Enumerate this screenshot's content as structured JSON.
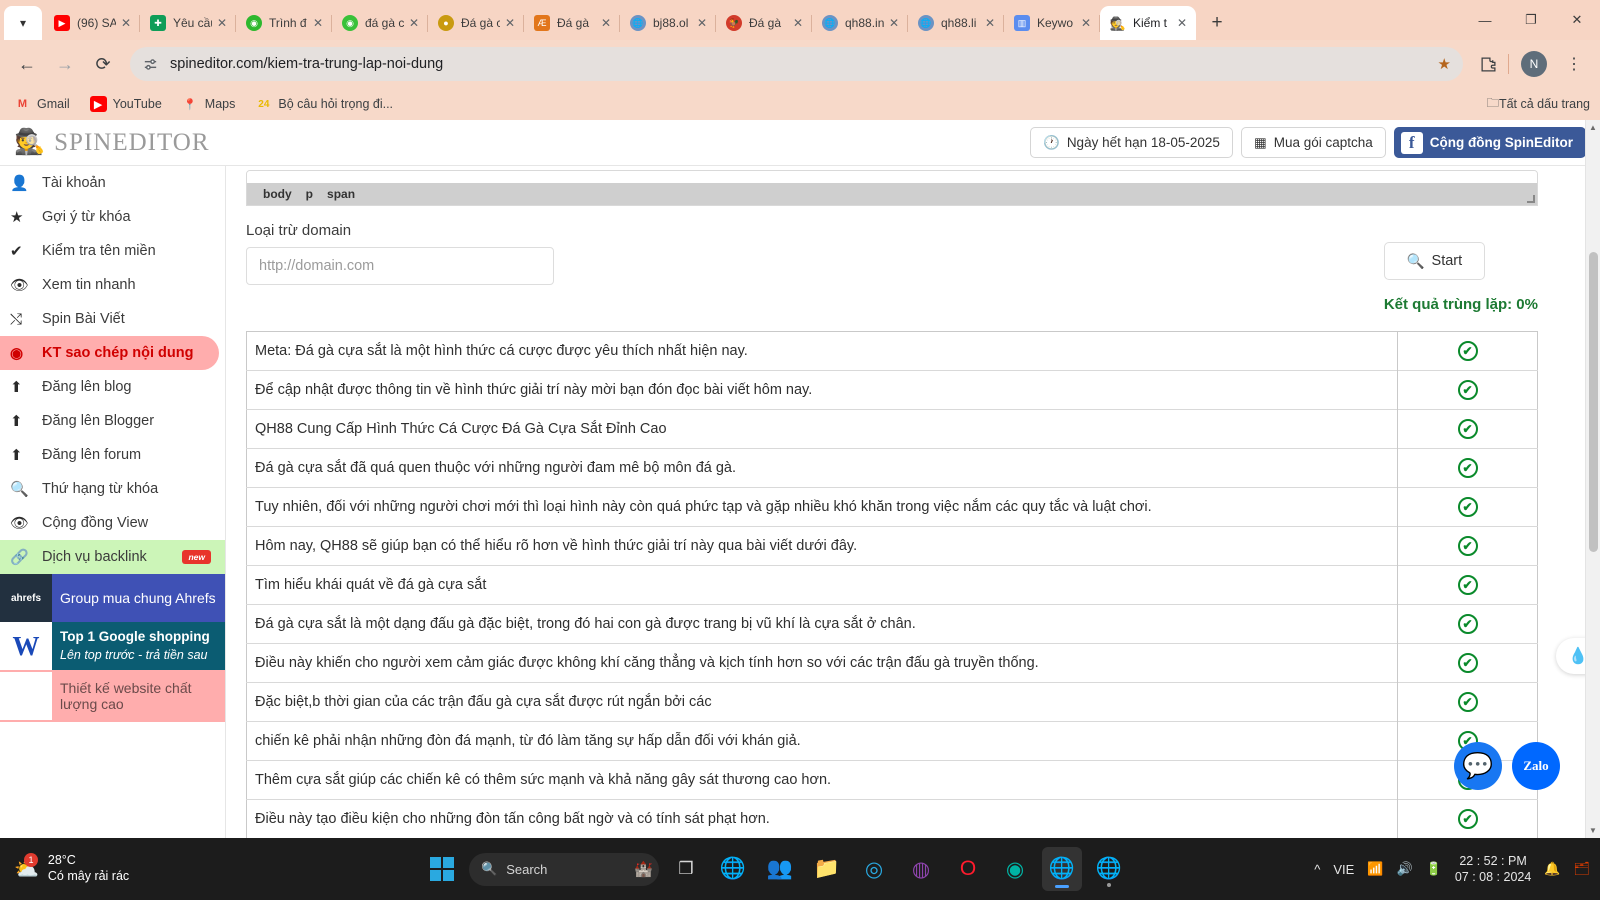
{
  "browser": {
    "tab_list_icon": "chevron-down",
    "tabs": [
      {
        "title": "(96) SA",
        "favicon": "youtube",
        "active": false
      },
      {
        "title": "Yêu cầu",
        "favicon": "forms",
        "active": false
      },
      {
        "title": "Trình đ",
        "favicon": "spin-green",
        "active": false
      },
      {
        "title": "đá gà c",
        "favicon": "spin-green2",
        "active": false
      },
      {
        "title": "Đá gà c",
        "favicon": "gold-coin",
        "active": false
      },
      {
        "title": "Đá gà",
        "favicon": "ae-orange",
        "active": false
      },
      {
        "title": "bj88.ol",
        "favicon": "globe",
        "active": false
      },
      {
        "title": "Đá gà",
        "favicon": "rooster-red",
        "active": false
      },
      {
        "title": "qh88.in",
        "favicon": "globe",
        "active": false
      },
      {
        "title": "qh88.li",
        "favicon": "globe",
        "active": false
      },
      {
        "title": "Keywo",
        "favicon": "audio-bars",
        "active": false
      },
      {
        "title": "Kiểm t",
        "favicon": "spy",
        "active": true
      }
    ],
    "new_tab_label": "+",
    "window_controls": {
      "minimize": "—",
      "maximize": "❐",
      "close": "✕"
    },
    "nav": {
      "back": "←",
      "forward": "→",
      "reload": "⟳"
    },
    "address": {
      "url": "spineditor.com/kiem-tra-trung-lap-noi-dung",
      "site_icon": "tune-icon",
      "star_icon": "star-filled"
    },
    "toolbar_icons": {
      "extensions": "puzzle-icon",
      "profile_initial": "N",
      "menu": "⋮"
    },
    "bookmarks": [
      {
        "label": "Gmail",
        "icon": "M"
      },
      {
        "label": "YouTube",
        "icon": "▶"
      },
      {
        "label": "Maps",
        "icon": "📍"
      },
      {
        "label": "Bộ câu hỏi trọng đi...",
        "icon": "24"
      }
    ],
    "bookmarks_right": {
      "label": "Tất cả dấu trang",
      "icon": "folder-icon"
    }
  },
  "site": {
    "logo_text": "SPINEDITOR",
    "header_buttons": [
      {
        "label": "Ngày hết hạn 18-05-2025",
        "icon": "clock-icon"
      },
      {
        "label": "Mua gói captcha",
        "icon": "qr-icon"
      },
      {
        "label": "Cộng đồng SpinEditor",
        "icon": "facebook-icon"
      }
    ]
  },
  "sidebar": {
    "items": [
      {
        "label": "Tài khoản",
        "icon": "user-icon"
      },
      {
        "label": "Gợi ý từ khóa",
        "icon": "star-icon"
      },
      {
        "label": "Kiểm tra tên miền",
        "icon": "check-icon"
      },
      {
        "label": "Xem tin nhanh",
        "icon": "eye-icon"
      },
      {
        "label": "Spin Bài Viết",
        "icon": "shuffle-icon"
      },
      {
        "label": "KT sao chép nội dung",
        "icon": "target-icon"
      },
      {
        "label": "Đăng lên blog",
        "icon": "upload-icon"
      },
      {
        "label": "Đăng lên Blogger",
        "icon": "upload-icon"
      },
      {
        "label": "Đăng lên forum",
        "icon": "upload-icon"
      },
      {
        "label": "Thứ hạng từ khóa",
        "icon": "search-icon"
      },
      {
        "label": "Cộng đồng View",
        "icon": "eye-icon"
      }
    ],
    "backlink": {
      "label": "Dịch vụ backlink",
      "icon": "link-icon",
      "badge": "new"
    },
    "promos": [
      {
        "title": "Group mua chung Ahrefs",
        "subtitle": "",
        "logo": "ahrefs"
      },
      {
        "title": "Top 1 Google shopping",
        "subtitle": "Lên top trước - trả tiền sau",
        "logo": "W"
      },
      {
        "title": "Thiết kế website chất lượng cao",
        "subtitle": "",
        "logo": "website"
      }
    ]
  },
  "main": {
    "editor_status_tags": [
      "body",
      "p",
      "span"
    ],
    "exclude_domain_label": "Loại trừ domain",
    "exclude_domain_value": "",
    "exclude_domain_placeholder": "http://domain.com",
    "start_button_label": "Start",
    "start_button_icon": "search-icon",
    "duplicate_result": "Kết quả trùng lặp: 0%",
    "rows": [
      {
        "text": "Meta: Đá gà cựa sắt là một hình thức cá cược được yêu thích nhất hiện nay.",
        "status": "ok"
      },
      {
        "text": "Để cập nhật được thông tin về hình thức giải trí này mời bạn đón đọc bài viết hôm nay.",
        "status": "ok"
      },
      {
        "text": "QH88 Cung Cấp Hình Thức Cá Cược Đá Gà Cựa Sắt Đỉnh Cao",
        "status": "ok"
      },
      {
        "text": "Đá gà cựa sắt đã quá quen thuộc với những người đam mê bộ môn đá gà.",
        "status": "ok"
      },
      {
        "text": "Tuy nhiên, đối với những người chơi mới thì loại hình này còn quá phức tạp và gặp nhiều khó khăn trong việc nắm các quy tắc và luật chơi.",
        "status": "ok"
      },
      {
        "text": "Hôm nay, QH88 sẽ giúp bạn có thể hiểu rõ hơn về hình thức giải trí này qua bài viết dưới đây.",
        "status": "ok"
      },
      {
        "text": "Tìm hiểu khái quát về đá gà cựa sắt",
        "status": "ok"
      },
      {
        "text": "Đá gà cựa sắt là một dạng đấu gà đặc biệt, trong đó hai con gà được trang bị vũ khí là cựa sắt ở chân.",
        "status": "ok"
      },
      {
        "text": "Điều này khiến cho người xem cảm giác được không khí căng thẳng và kịch tính hơn so với các trận đấu gà truyền thống.",
        "status": "ok"
      },
      {
        "text": "Đặc biệt,b thời gian của các trận đấu gà cựa sắt được rút ngắn bởi các",
        "status": "ok"
      },
      {
        "text": "chiến kê phải nhận những đòn đá mạnh, từ đó làm tăng sự hấp dẫn đối với khán giả.",
        "status": "ok"
      },
      {
        "text": "Thêm cựa sắt giúp các chiến kê có thêm sức mạnh và khả năng gây sát thương cao hơn.",
        "status": "ok"
      },
      {
        "text": "Điều này tạo điều kiện cho những đòn tấn công bất ngờ và có tính sát phạt hơn.",
        "status": "ok"
      },
      {
        "text": "",
        "status": "ok"
      }
    ],
    "status_icon": "check-circle-icon",
    "floating": {
      "drop_widget": "water-drop-icon",
      "messenger": "messenger-icon",
      "zalo": "Zalo"
    }
  },
  "taskbar": {
    "weather": {
      "temp": "28°C",
      "desc": "Có mây rải rác",
      "badge": "1",
      "icon": "cloud-icon"
    },
    "search_placeholder": "Search",
    "search_icon": "search-icon",
    "start_icon": "windows-logo",
    "apps": [
      {
        "name": "task-view",
        "icon": "task-view-icon"
      },
      {
        "name": "chrome",
        "icon": "chrome-icon"
      },
      {
        "name": "teams",
        "icon": "teams-icon"
      },
      {
        "name": "file-explorer",
        "icon": "folder-icon"
      },
      {
        "name": "edge",
        "icon": "edge-icon"
      },
      {
        "name": "browser-purple",
        "icon": "browser-icon"
      },
      {
        "name": "opera",
        "icon": "opera-icon"
      },
      {
        "name": "antivirus",
        "icon": "shield-icon"
      },
      {
        "name": "chrome-active",
        "icon": "chrome-icon"
      },
      {
        "name": "chrome-profile",
        "icon": "chrome-icon"
      }
    ],
    "tray": {
      "chevron": "^",
      "language": "VIE",
      "wifi": "wifi-icon",
      "volume": "volume-icon",
      "battery": "battery-icon",
      "bell": "bell-icon"
    },
    "clock": {
      "time": "22 : 52 : PM",
      "date": "07 : 08 : 2024"
    }
  },
  "colors": {
    "tabstrip": "#f7d9c9",
    "accent_red": "#d00000",
    "accent_green": "#1d7a33",
    "facebook_blue": "#3b5998",
    "taskbar": "#1c1c1c"
  }
}
